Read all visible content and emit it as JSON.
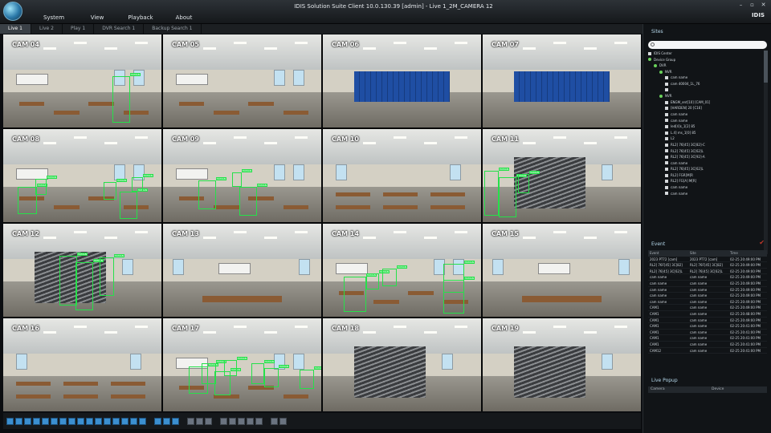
{
  "app": {
    "title": "IDIS Solution Suite Client 10.0.130.39 [admin] - Live 1_2M_CAMERA 12",
    "brand": "IDIS",
    "window_controls": [
      "–",
      "▫",
      "✕"
    ]
  },
  "menu": [
    "System",
    "View",
    "Playback",
    "About"
  ],
  "tabs": [
    {
      "label": "Live 1",
      "active": true
    },
    {
      "label": "Live 2",
      "active": false
    },
    {
      "label": "Play 1",
      "active": false
    },
    {
      "label": "DVR Search 1",
      "active": false
    },
    {
      "label": "Backup Search 1",
      "active": false
    }
  ],
  "cameras": [
    {
      "label": "CAM 04",
      "scene": "classroom"
    },
    {
      "label": "CAM 05",
      "scene": "classroom"
    },
    {
      "label": "CAM 06",
      "scene": "lockers"
    },
    {
      "label": "CAM 07",
      "scene": "lockers"
    },
    {
      "label": "CAM 08",
      "scene": "classroom"
    },
    {
      "label": "CAM 09",
      "scene": "classroom"
    },
    {
      "label": "CAM 10",
      "scene": "cafeteria"
    },
    {
      "label": "CAM 11",
      "scene": "stairs"
    },
    {
      "label": "CAM 12",
      "scene": "stairs"
    },
    {
      "label": "CAM 13",
      "scene": "hall"
    },
    {
      "label": "CAM 14",
      "scene": "classroom"
    },
    {
      "label": "CAM 15",
      "scene": "hall"
    },
    {
      "label": "CAM 16",
      "scene": "cafeteria"
    },
    {
      "label": "CAM 17",
      "scene": "classroom"
    },
    {
      "label": "CAM 18",
      "scene": "stairs"
    },
    {
      "label": "CAM 19",
      "scene": "stairs"
    }
  ],
  "detection_tag": "HUMAN",
  "sites": {
    "title": "Sites",
    "tree": [
      {
        "label": "IDIS Center",
        "depth": 0,
        "kind": "sq"
      },
      {
        "label": "Device Group",
        "depth": 0,
        "kind": "dot"
      },
      {
        "label": "DVR",
        "depth": 1,
        "kind": "dot"
      },
      {
        "label": "NVR",
        "depth": 2,
        "kind": "dot"
      },
      {
        "label": "cam name",
        "depth": 3,
        "kind": "sq"
      },
      {
        "label": "cam 40004_1L_76",
        "depth": 3,
        "kind": "sq"
      },
      {
        "label": "",
        "depth": 3,
        "kind": "sq"
      },
      {
        "label": "NVR",
        "depth": 2,
        "kind": "dot"
      },
      {
        "label": "ENGM_ent[10] [CAM_01]",
        "depth": 3,
        "kind": "sq"
      },
      {
        "label": "[HARDEN] 20 [C16]",
        "depth": 3,
        "kind": "sq"
      },
      {
        "label": "cam name",
        "depth": 3,
        "kind": "sq"
      },
      {
        "label": "cam name",
        "depth": 3,
        "kind": "sq"
      },
      {
        "label": "led[4]s_1[2] 85",
        "depth": 3,
        "kind": "sq"
      },
      {
        "label": "L.4] ms_1[0] 85",
        "depth": 3,
        "kind": "sq"
      },
      {
        "label": "L2",
        "depth": 3,
        "kind": "sq"
      },
      {
        "label": "RL2] 76[45] 3C[82]-C",
        "depth": 3,
        "kind": "sq"
      },
      {
        "label": "RL2] 76[45] 3C[62]L",
        "depth": 3,
        "kind": "sq"
      },
      {
        "label": "RL2] 76[45] 3C[92]-A",
        "depth": 3,
        "kind": "sq"
      },
      {
        "label": "cam name",
        "depth": 3,
        "kind": "sq"
      },
      {
        "label": "RL2] 76[45] 3C[62]L",
        "depth": 3,
        "kind": "sq"
      },
      {
        "label": "RL2] FGR[M]R",
        "depth": 3,
        "kind": "sq"
      },
      {
        "label": "RL2] FG[A] M[R]",
        "depth": 3,
        "kind": "sq"
      },
      {
        "label": "cam name",
        "depth": 3,
        "kind": "sq"
      },
      {
        "label": "cam name",
        "depth": 3,
        "kind": "sq"
      }
    ]
  },
  "events": {
    "title": "Event",
    "columns": [
      "Event",
      "Site",
      "Time"
    ],
    "rows": [
      [
        "2023 PT72 [cam]",
        "2023 PT72 [cam]",
        "02-25 20:49:00 PM"
      ],
      [
        "RL2] 76F[45] 3C[82]",
        "RL2] 76F[45] 3C[82]",
        "02-25 20:49:00 PM"
      ],
      [
        "RL2] 76[45] 3C[62]L",
        "RL2] 76[45] 3C[62]L",
        "02-25 20:49:00 PM"
      ],
      [
        "cam name",
        "cam name",
        "02-25 20:49:00 PM"
      ],
      [
        "cam name",
        "cam name",
        "02-25 20:49:00 PM"
      ],
      [
        "cam name",
        "cam name",
        "02-25 20:49:00 PM"
      ],
      [
        "cam name",
        "cam name",
        "02-25 20:49:00 PM"
      ],
      [
        "cam name",
        "cam name",
        "02-25 20:49:00 PM"
      ],
      [
        "CAM1",
        "cam name",
        "02-25 20:49:00 PM"
      ],
      [
        "CAM1",
        "cam name",
        "02-25 20:48:00 PM"
      ],
      [
        "CAM1",
        "cam name",
        "02-25 20:49:00 PM"
      ],
      [
        "CAM1",
        "cam name",
        "02-25 20:41:00 PM"
      ],
      [
        "CAM1",
        "cam name",
        "02-25 20:41:00 PM"
      ],
      [
        "CAM1",
        "cam name",
        "02-25 20:41:00 PM"
      ],
      [
        "CAM1",
        "cam name",
        "02-25 20:41:00 PM"
      ],
      [
        "CAM12",
        "cam name",
        "02-25 20:41:00 PM"
      ]
    ]
  },
  "live_popup": {
    "title": "Live Popup",
    "columns": [
      "Camera",
      "Device"
    ]
  },
  "colors": {
    "accent": "#b6d9ec",
    "detection": "#26e04a",
    "toolbar_icon": "#3b8fd0"
  }
}
